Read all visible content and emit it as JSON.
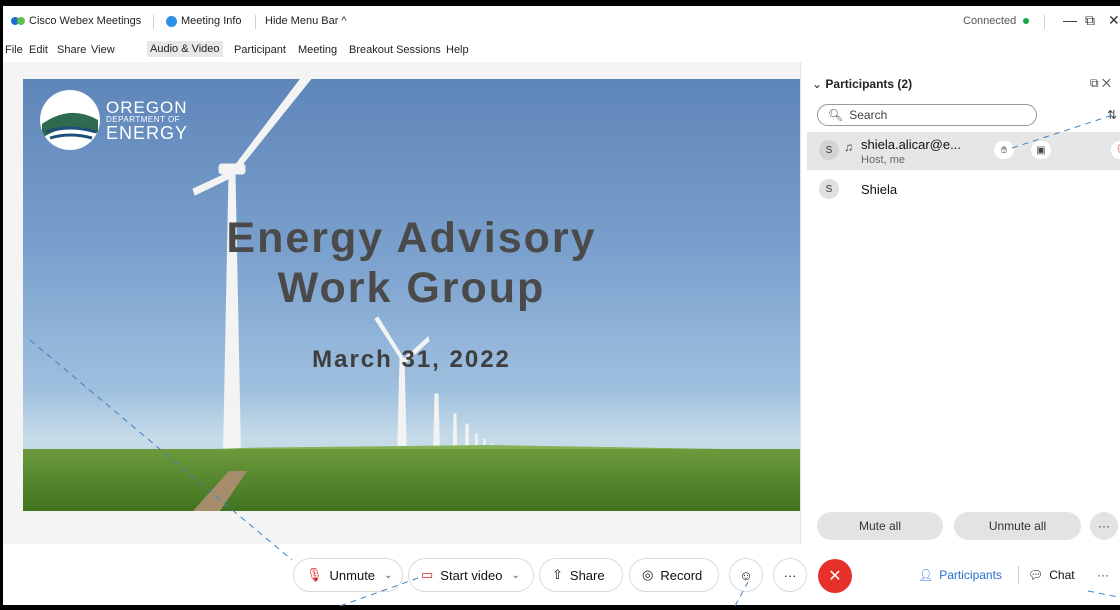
{
  "titlebar": {
    "app_name": "Cisco Webex Meetings",
    "meeting_info": "Meeting Info",
    "hide_menu_bar": "Hide Menu Bar ^",
    "status": "Connected"
  },
  "menu": [
    "File",
    "Edit",
    "Share",
    "View",
    "Audio & Video",
    "Participant",
    "Meeting",
    "Breakout Sessions",
    "Help"
  ],
  "slide": {
    "logo_line1": "OREGON",
    "logo_line2": "DEPARTMENT OF",
    "logo_line3": "ENERGY",
    "title_line1": "Energy Advisory",
    "title_line2": "Work Group",
    "date": "March 31, 2022"
  },
  "panel": {
    "title": "Participants (2)",
    "search_placeholder": "Search",
    "participants": [
      {
        "initial": "S",
        "name": "shiela.alicar@e...",
        "role": "Host, me"
      },
      {
        "initial": "S",
        "name": "Shiela",
        "role": ""
      }
    ],
    "mute_all": "Mute all",
    "unmute_all": "Unmute all",
    "more": "···"
  },
  "controls": {
    "unmute": "Unmute",
    "start_video": "Start video",
    "share": "Share",
    "record": "Record",
    "more": "···",
    "participants_tab": "Participants",
    "chat_tab": "Chat",
    "tabs_more": "···"
  },
  "colors": {
    "accent": "#2b8fe6",
    "end_button": "#e6302a",
    "connected": "#1aa34a",
    "muted": "#d6282e"
  }
}
